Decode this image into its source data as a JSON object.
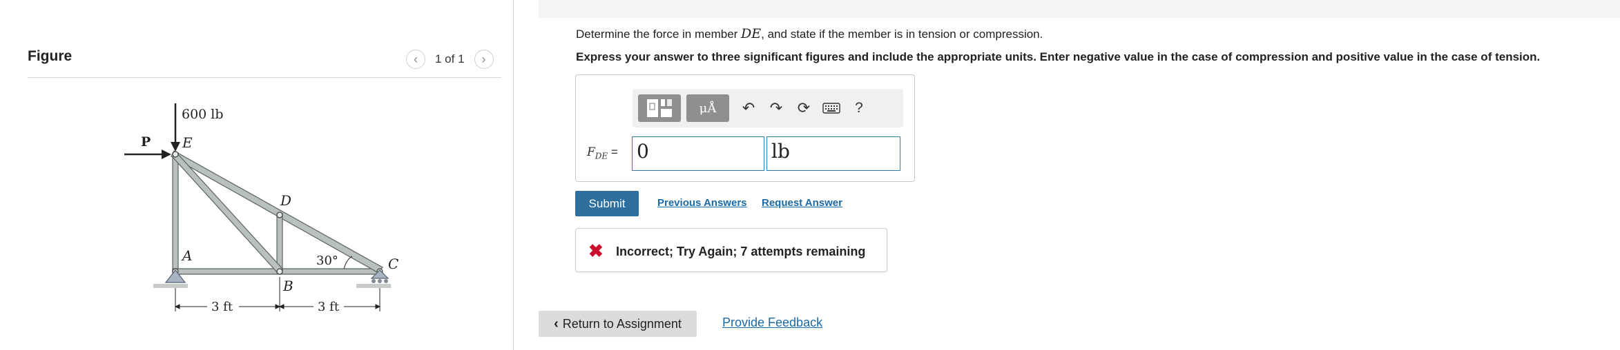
{
  "figure": {
    "title": "Figure",
    "pager_text": "1 of 1",
    "prev_icon": "chevron-left-icon",
    "next_icon": "chevron-right-icon",
    "diagram": {
      "load_label": "600 lb",
      "force_label": "P",
      "joints": [
        "A",
        "B",
        "C",
        "D",
        "E"
      ],
      "angle_label": "30°",
      "dim_left": "3 ft",
      "dim_right": "3 ft"
    }
  },
  "problem": {
    "question_prefix": "Determine the force in member ",
    "question_var": "DE",
    "question_suffix": ", and state if the member is in tension or compression.",
    "instructions": "Express your answer to three significant figures and include the appropriate units. Enter negative value in the case of compression and positive value in the case of tension."
  },
  "answer": {
    "label_main": "F",
    "label_sub": "DE",
    "label_eq": " =",
    "value": "0",
    "unit": "lb",
    "toolbar": {
      "templates_icon": "templates-icon",
      "units_icon": "units-mu-icon",
      "units_glyph": "μÅ",
      "undo_icon": "undo-icon",
      "redo_icon": "redo-icon",
      "reset_icon": "reset-icon",
      "keyboard_icon": "keyboard-icon",
      "help_label": "?"
    }
  },
  "actions": {
    "submit": "Submit",
    "previous_answers": "Previous Answers",
    "request_answer": "Request Answer"
  },
  "feedback": {
    "icon": "x-mark-icon",
    "message": "Incorrect; Try Again; 7 attempts remaining"
  },
  "footer": {
    "return": "Return to Assignment",
    "provide_feedback": "Provide Feedback"
  },
  "colors": {
    "accent": "#2e6f9e",
    "link": "#1a6aa5",
    "error": "#c8102e",
    "input_border": "#2d7cb0"
  }
}
